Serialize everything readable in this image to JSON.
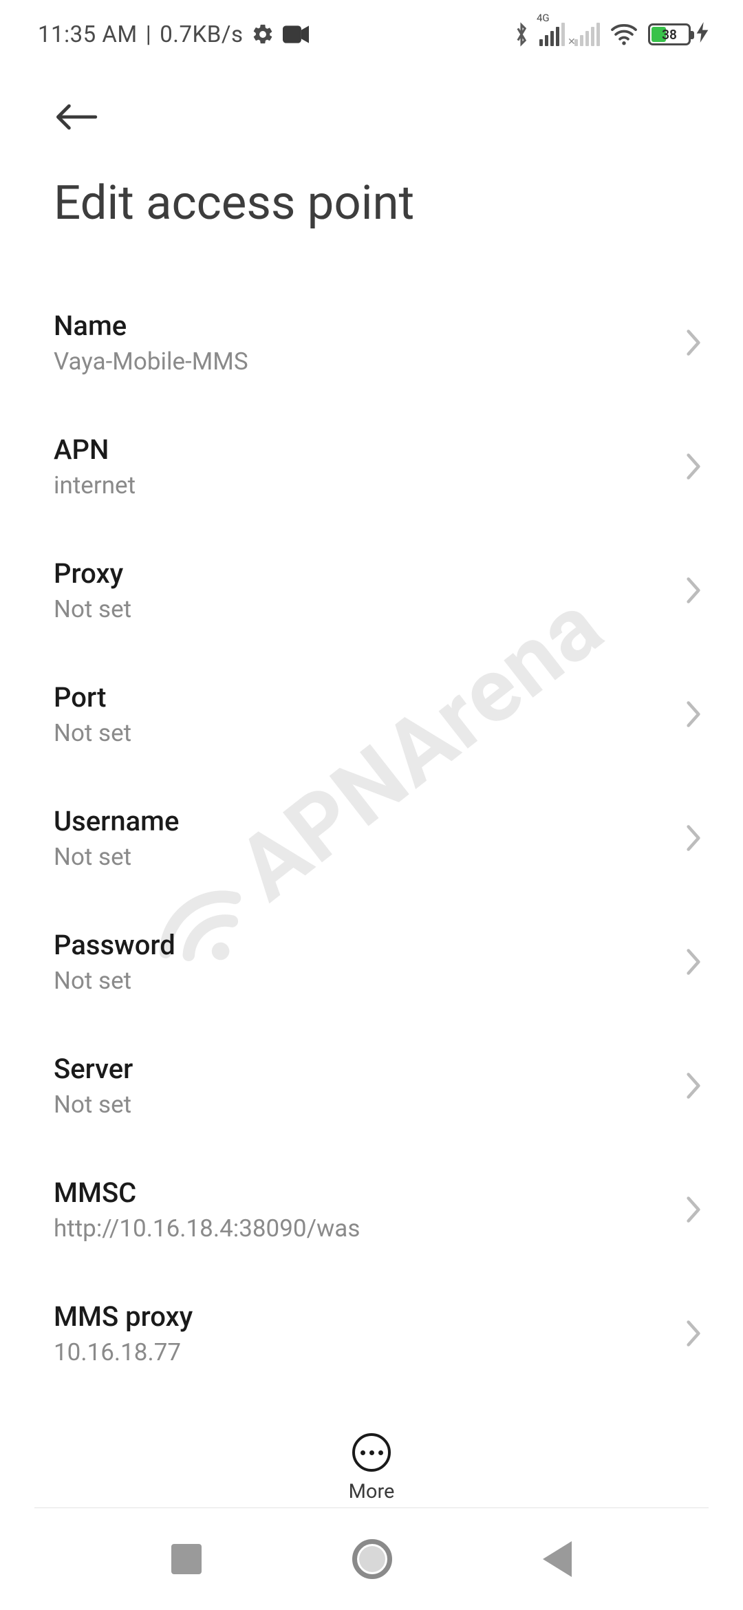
{
  "status": {
    "time": "11:35 AM",
    "sep": "|",
    "net_speed": "0.7KB/s",
    "signal1_tag": "4G",
    "battery_pct": "38"
  },
  "header": {
    "title": "Edit access point"
  },
  "rows": [
    {
      "label": "Name",
      "value": "Vaya-Mobile-MMS"
    },
    {
      "label": "APN",
      "value": "internet"
    },
    {
      "label": "Proxy",
      "value": "Not set"
    },
    {
      "label": "Port",
      "value": "Not set"
    },
    {
      "label": "Username",
      "value": "Not set"
    },
    {
      "label": "Password",
      "value": "Not set"
    },
    {
      "label": "Server",
      "value": "Not set"
    },
    {
      "label": "MMSC",
      "value": "http://10.16.18.4:38090/was"
    },
    {
      "label": "MMS proxy",
      "value": "10.16.18.77"
    }
  ],
  "more_label": "More",
  "watermark": "APNArena"
}
